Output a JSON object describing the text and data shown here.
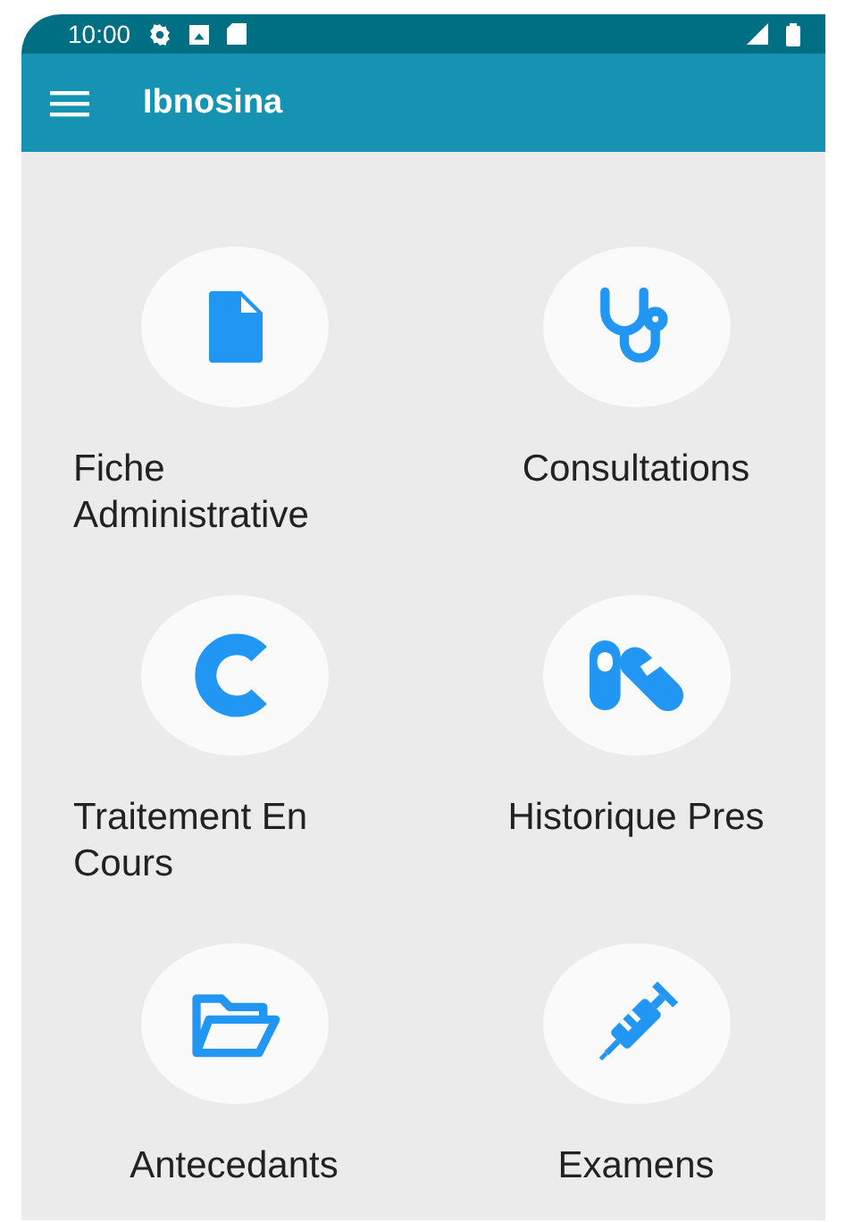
{
  "status_bar": {
    "time": "10:00"
  },
  "app_bar": {
    "title": "Ibnosina"
  },
  "tiles": [
    {
      "label": "Fiche Administrative"
    },
    {
      "label": "Consultations"
    },
    {
      "label": "Traitement En Cours"
    },
    {
      "label": "Historique Pres"
    },
    {
      "label": "Antecedants"
    },
    {
      "label": "Examens"
    }
  ]
}
